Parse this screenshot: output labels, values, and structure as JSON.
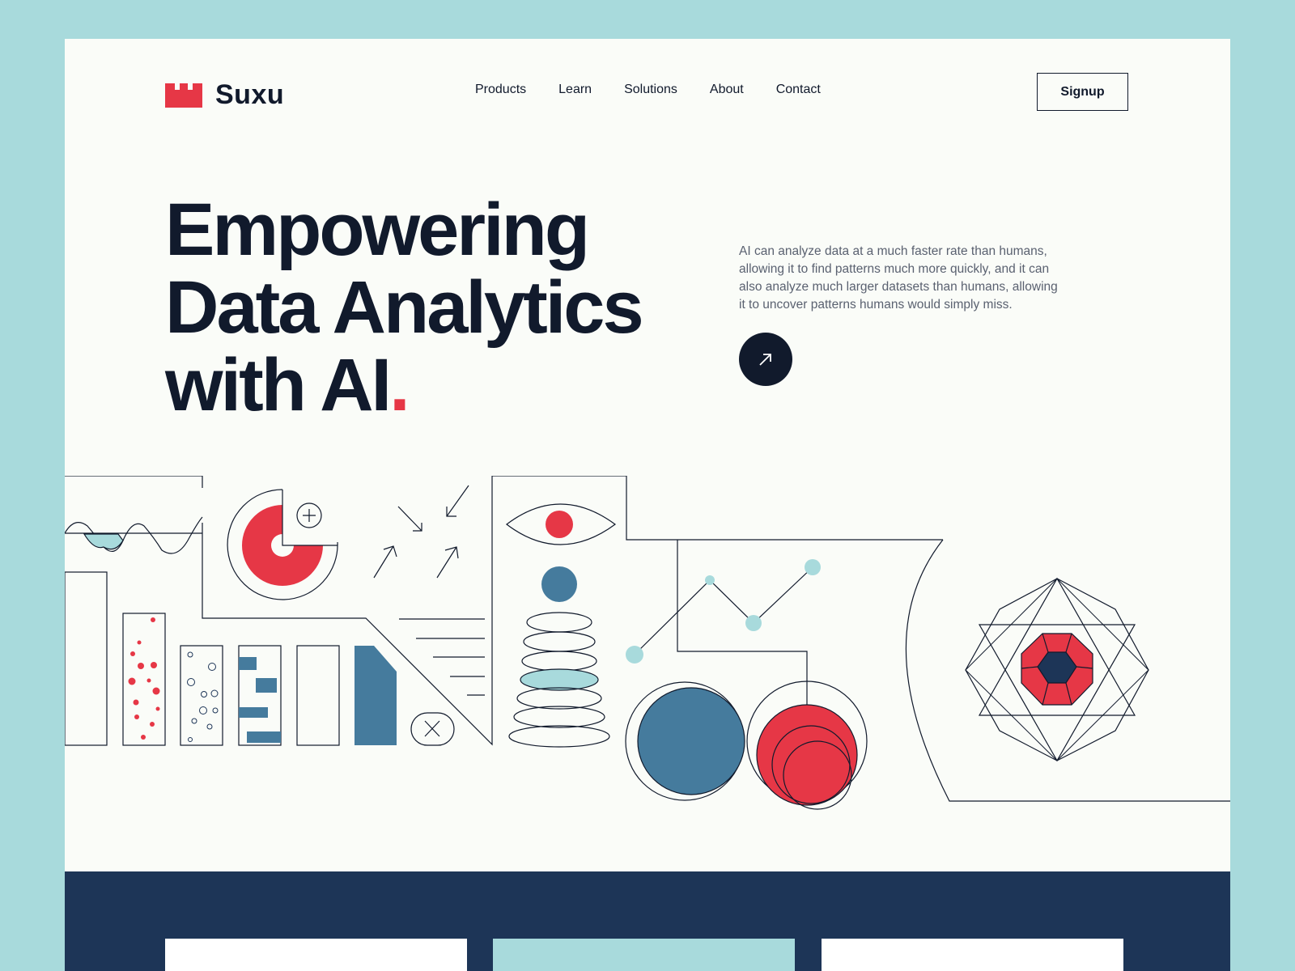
{
  "brand": {
    "name": "Suxu",
    "accent": "#e63746",
    "dark": "#111a2c",
    "navy": "#1d3557",
    "teal": "#a8dadc",
    "steel": "#457b9d"
  },
  "nav": {
    "items": [
      "Products",
      "Learn",
      "Solutions",
      "About",
      "Contact"
    ]
  },
  "header": {
    "signup_label": "Signup"
  },
  "hero": {
    "title_lines": [
      "Empowering",
      "Data Analytics",
      "with AI"
    ],
    "title_dot": ".",
    "description": "AI can analyze data at a much faster rate than humans, allowing it to find patterns much more quickly, and it can also analyze much larger datasets than humans, allowing it to uncover patterns humans would simply miss.",
    "cta_icon": "arrow-up-right-icon"
  },
  "cards": [
    "card-white",
    "card-teal",
    "card-white"
  ]
}
